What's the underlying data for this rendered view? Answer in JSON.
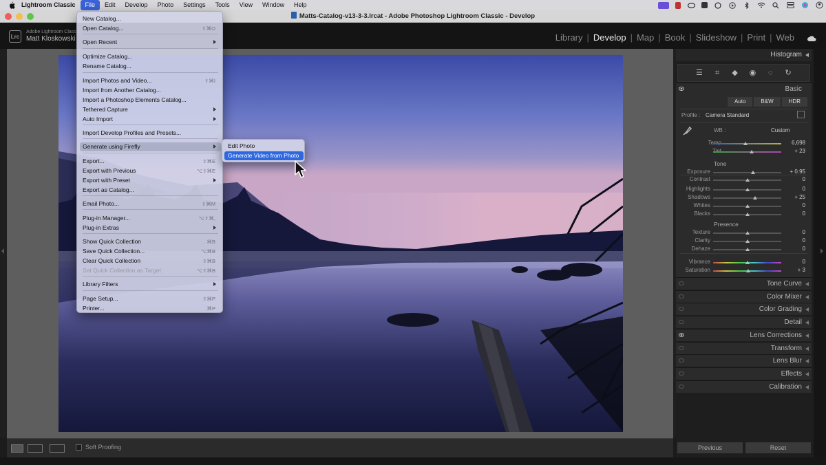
{
  "menubar": {
    "app_name": "Lightroom Classic",
    "items": [
      "File",
      "Edit",
      "Develop",
      "Photo",
      "Settings",
      "Tools",
      "View",
      "Window",
      "Help"
    ],
    "active": "File"
  },
  "window": {
    "title": "Matts-Catalog-v13-3-3.lrcat - Adobe Photoshop Lightroom Classic - Develop"
  },
  "identity": {
    "logo": "Lrc",
    "product": "Adobe Lightroom Classic",
    "user": "Matt Kloskowski"
  },
  "modules": [
    "Library",
    "Develop",
    "Map",
    "Book",
    "Slideshow",
    "Print",
    "Web"
  ],
  "active_module": "Develop",
  "file_menu": {
    "items": [
      {
        "label": "New Catalog...",
        "shortcut": ""
      },
      {
        "label": "Open Catalog...",
        "shortcut": "⇧⌘O"
      },
      {
        "label": "Open Recent",
        "shortcut": "",
        "submenu": true
      },
      {
        "label": "Optimize Catalog...",
        "shortcut": ""
      },
      {
        "label": "Rename Catalog...",
        "shortcut": ""
      },
      {
        "label": "Import Photos and Video...",
        "shortcut": "⇧⌘I"
      },
      {
        "label": "Import from Another Catalog...",
        "shortcut": ""
      },
      {
        "label": "Import a Photoshop Elements Catalog...",
        "shortcut": ""
      },
      {
        "label": "Tethered Capture",
        "shortcut": "",
        "submenu": true
      },
      {
        "label": "Auto Import",
        "shortcut": "",
        "submenu": true
      },
      {
        "label": "Import Develop Profiles and Presets...",
        "shortcut": ""
      },
      {
        "label": "Generate using Firefly",
        "shortcut": "",
        "submenu": true
      },
      {
        "label": "Export...",
        "shortcut": "⇧⌘E"
      },
      {
        "label": "Export with Previous",
        "shortcut": "⌥⇧⌘E"
      },
      {
        "label": "Export with Preset",
        "shortcut": "",
        "submenu": true
      },
      {
        "label": "Export as Catalog...",
        "shortcut": ""
      },
      {
        "label": "Email Photo...",
        "shortcut": "⇧⌘M"
      },
      {
        "label": "Plug-in Manager...",
        "shortcut": "⌥⇧⌘,"
      },
      {
        "label": "Plug-in Extras",
        "shortcut": "",
        "submenu": true
      },
      {
        "label": "Show Quick Collection",
        "shortcut": "⌘B"
      },
      {
        "label": "Save Quick Collection...",
        "shortcut": "⌥⌘B"
      },
      {
        "label": "Clear Quick Collection",
        "shortcut": "⇧⌘B"
      },
      {
        "label": "Set Quick Collection as Target",
        "shortcut": "⌥⇧⌘B"
      },
      {
        "label": "Library Filters",
        "shortcut": "",
        "submenu": true
      },
      {
        "label": "Page Setup...",
        "shortcut": "⇧⌘P"
      },
      {
        "label": "Printer...",
        "shortcut": "⌘P"
      }
    ]
  },
  "firefly_submenu": {
    "items": [
      "Edit Photo",
      "Generate Video from Photo"
    ],
    "selected": "Generate Video from Photo"
  },
  "toolbar": {
    "soft_proofing": "Soft Proofing"
  },
  "right_panel": {
    "histogram": "Histogram",
    "basic": {
      "title": "Basic",
      "treatment_buttons": [
        "Auto",
        "B&W",
        "HDR"
      ],
      "profile_label": "Profile :",
      "profile_value": "Camera Standard",
      "wb_label": "WB :",
      "wb_value": "Custom",
      "tone_section": "Tone",
      "presence_section": "Presence",
      "sliders": [
        {
          "label": "Temp",
          "value": "6,698",
          "pos": 0.47
        },
        {
          "label": "Tint",
          "value": "+ 23",
          "pos": 0.57
        },
        {
          "label": "Exposure",
          "value": "+ 0.95",
          "pos": 0.59
        },
        {
          "label": "Contrast",
          "value": "0",
          "pos": 0.5
        },
        {
          "label": "Highlights",
          "value": "0",
          "pos": 0.5
        },
        {
          "label": "Shadows",
          "value": "+ 25",
          "pos": 0.62
        },
        {
          "label": "Whites",
          "value": "0",
          "pos": 0.5
        },
        {
          "label": "Blacks",
          "value": "0",
          "pos": 0.5
        },
        {
          "label": "Texture",
          "value": "0",
          "pos": 0.5
        },
        {
          "label": "Clarity",
          "value": "0",
          "pos": 0.5
        },
        {
          "label": "Dehaze",
          "value": "0",
          "pos": 0.5
        },
        {
          "label": "Vibrance",
          "value": "0",
          "pos": 0.5
        },
        {
          "label": "Saturation",
          "value": "+ 3",
          "pos": 0.52
        }
      ]
    },
    "panels": [
      "Tone Curve",
      "Color Mixer",
      "Color Grading",
      "Detail",
      "Lens Corrections",
      "Transform",
      "Lens Blur",
      "Effects",
      "Calibration"
    ],
    "previous_button": "Previous",
    "reset_button": "Reset"
  }
}
